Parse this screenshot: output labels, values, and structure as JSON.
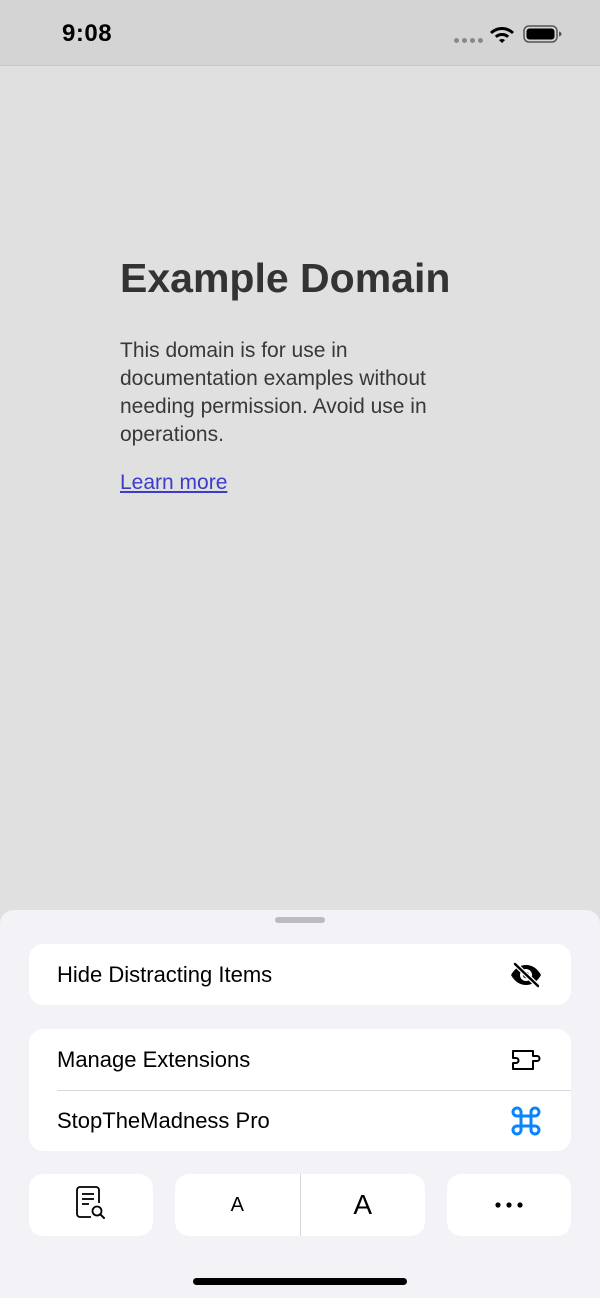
{
  "status_bar": {
    "time": "9:08",
    "icons": [
      "signal-dots-icon",
      "wifi-icon",
      "battery-icon"
    ]
  },
  "webpage": {
    "title": "Example Domain",
    "body": "This domain is for use in documentation examples without needing permission. Avoid use in operations.",
    "link": "Learn more",
    "link_color": "#3c3cc6"
  },
  "sheet": {
    "hide_distracting": {
      "label": "Hide Distracting Items",
      "icon": "eye-slash-icon"
    },
    "extensions": [
      {
        "label": "Manage Extensions",
        "icon": "extension-puzzle-icon"
      },
      {
        "label": "StopTheMadness Pro",
        "icon": "command-icon",
        "icon_color": "#0a84ff"
      }
    ],
    "toolbar": {
      "reader_icon": "page-search-icon",
      "font_smaller": "A",
      "font_larger": "A",
      "more_icon": "ellipsis-icon"
    }
  }
}
